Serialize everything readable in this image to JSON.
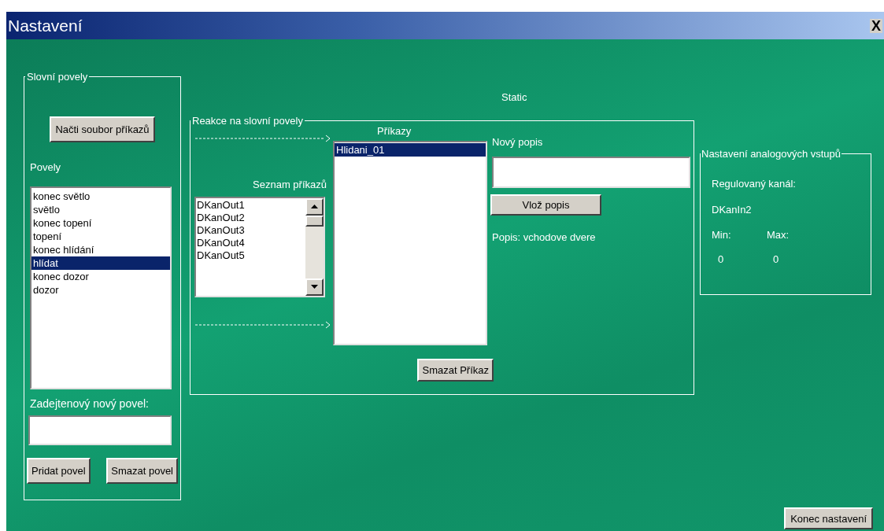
{
  "window": {
    "title": "Nastavení",
    "close": "X"
  },
  "static_label": "Static",
  "voice_commands": {
    "title": "Slovní povely",
    "load_button": "Načti soubor příkazů",
    "list_label": "Povely",
    "items": [
      {
        "label": "konec světlo",
        "selected": false
      },
      {
        "label": "světlo",
        "selected": false
      },
      {
        "label": "konec topení",
        "selected": false
      },
      {
        "label": "topení",
        "selected": false
      },
      {
        "label": "konec hlídání",
        "selected": false
      },
      {
        "label": "hlídat",
        "selected": true
      },
      {
        "label": "konec dozor",
        "selected": false
      },
      {
        "label": "dozor",
        "selected": false
      }
    ],
    "new_label": "Zadejtenový nový povel:",
    "add_button": "Pridat povel",
    "delete_button": "Smazat povel"
  },
  "reactions": {
    "title": "Reakce na slovní povely",
    "commands_label": "Příkazy",
    "commands": [
      {
        "label": "Hlidani_01",
        "selected": true
      }
    ],
    "list_label": "Seznam příkazů",
    "list_items": [
      "DKanOut1",
      "DKanOut2",
      "DKanOut3",
      "DKanOut4",
      "DKanOut5"
    ],
    "delete_button": "Smazat Příkaz",
    "description_label": "Nový popis",
    "insert_button": "Vlož popis",
    "description": "Popis: vchodove dvere"
  },
  "analog": {
    "title": "Nastavení analogových vstupů",
    "channel_label": "Regulovaný kanál:",
    "channel": "DKanIn2",
    "min_label": "Min:",
    "max_label": "Max:",
    "min": "0",
    "max": "0"
  },
  "close_button": "Konec nastavení"
}
